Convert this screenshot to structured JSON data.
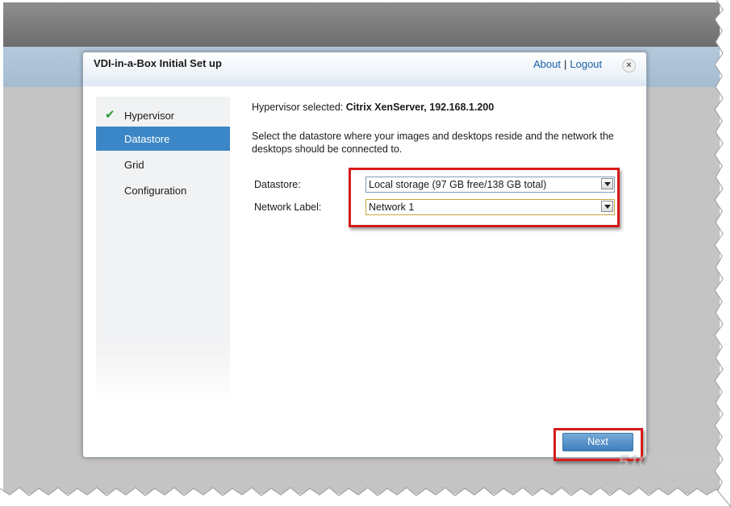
{
  "dialog": {
    "title": "VDI-in-a-Box Initial Set up",
    "about_link": "About",
    "separator": "|",
    "logout_link": "Logout",
    "close_symbol": "×"
  },
  "sidebar": {
    "items": [
      {
        "label": "Hypervisor",
        "status": "completed",
        "icon": "check-icon"
      },
      {
        "label": "Datastore",
        "status": "active"
      },
      {
        "label": "Grid",
        "status": "pending"
      },
      {
        "label": "Configuration",
        "status": "pending"
      }
    ]
  },
  "content": {
    "hypervisor_prefix": "Hypervisor selected: ",
    "hypervisor_value": "Citrix XenServer, 192.168.1.200",
    "description": "Select the datastore where your images and desktops reside and the network the desktops should be connected to.",
    "datastore_label": "Datastore:",
    "datastore_value": "Local storage (97 GB free/138 GB total)",
    "network_label": "Network Label:",
    "network_value": "Network 1",
    "next_button": "Next"
  },
  "watermark": {
    "main": "51CTO.com",
    "sub": "技术博客  Blog"
  },
  "colors": {
    "accent": "#3b86c6",
    "highlight_box": "#d61a1a",
    "check": "#2e9b34",
    "link": "#1a5fa8"
  }
}
